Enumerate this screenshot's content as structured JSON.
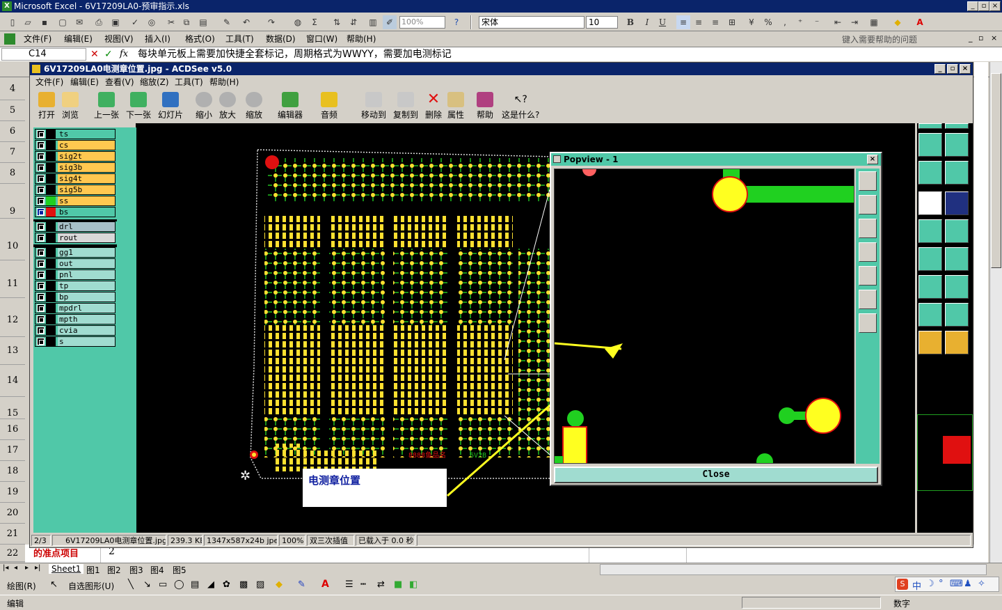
{
  "excel": {
    "title": "Microsoft Excel - 6V17209LA0-预审指示.xls",
    "menu": [
      "文件(F)",
      "编辑(E)",
      "视图(V)",
      "插入(I)",
      "格式(O)",
      "工具(T)",
      "数据(D)",
      "窗口(W)",
      "帮助(H)"
    ],
    "help_placeholder": "键入需要帮助的问题",
    "zoom": "100%",
    "font_name": "宋体",
    "font_size": "10",
    "cell_ref": "C14",
    "formula": "每块单元板上需要加快捷全套标记，周期格式为WWYY，需要加电测标记",
    "row_numbers": [
      "4",
      "5",
      "6",
      "7",
      "8",
      "9",
      "10",
      "11",
      "12",
      "13",
      "14",
      "15",
      "16",
      "17",
      "18",
      "19",
      "20",
      "21",
      "22"
    ],
    "row22_cell_a": "的准点项目",
    "row22_cell_b": "2",
    "sheet_tabs": [
      "Sheet1",
      "图1",
      "图2",
      "图3",
      "图4",
      "图5"
    ],
    "draw_label": "绘图(R)",
    "autoshape_label": "自选图形(U)",
    "status_left": "编辑",
    "status_right": "数字"
  },
  "acdsee": {
    "title": "6V17209LA0电测章位置.jpg - ACDSee v5.0",
    "menu": [
      "文件(F)",
      "编辑(E)",
      "查看(V)",
      "缩放(Z)",
      "工具(T)",
      "帮助(H)"
    ],
    "tools": [
      "打开",
      "浏览",
      "上一张",
      "下一张",
      "幻灯片",
      "缩小",
      "放大",
      "缩放",
      "编辑器",
      "音频",
      "移动到",
      "复制到",
      "删除",
      "属性",
      "帮助",
      "这是什么?"
    ],
    "layers": [
      {
        "name": "ts",
        "swatch": "#000000",
        "bg": "#50c8a8"
      },
      {
        "name": "cs",
        "swatch": "#000000",
        "bg": "#ffc850"
      },
      {
        "name": "sig2t",
        "swatch": "#000000",
        "bg": "#ffc850"
      },
      {
        "name": "sig3b",
        "swatch": "#000000",
        "bg": "#ffc850"
      },
      {
        "name": "sig4t",
        "swatch": "#000000",
        "bg": "#ffc850"
      },
      {
        "name": "sig5b",
        "swatch": "#000000",
        "bg": "#ffc850"
      },
      {
        "name": "ss",
        "swatch": "#20d020",
        "bg": "#ffc850"
      },
      {
        "name": "bs",
        "swatch": "#e01010",
        "bg": "#50c8a8"
      },
      {
        "name": "drl",
        "swatch": "#000000",
        "bg": "#a8c0c8"
      },
      {
        "name": "rout",
        "swatch": "#000000",
        "bg": "#d8d8d8"
      },
      {
        "name": "gg1",
        "swatch": "#000000",
        "bg": "#a0dcd0"
      },
      {
        "name": "out",
        "swatch": "#000000",
        "bg": "#a0dcd0"
      },
      {
        "name": "pnl",
        "swatch": "#000000",
        "bg": "#a0dcd0"
      },
      {
        "name": "tp",
        "swatch": "#000000",
        "bg": "#a0dcd0"
      },
      {
        "name": "bp",
        "swatch": "#000000",
        "bg": "#a0dcd0"
      },
      {
        "name": "mpdrl",
        "swatch": "#000000",
        "bg": "#a0dcd0"
      },
      {
        "name": "mpth",
        "swatch": "#000000",
        "bg": "#a0dcd0"
      },
      {
        "name": "cvia",
        "swatch": "#000000",
        "bg": "#a0dcd0"
      },
      {
        "name": "s",
        "swatch": "#000000",
        "bg": "#a0dcd0"
      }
    ],
    "annotation": "电测章位置",
    "pcb_text": "8888鱼品名\n6V2B",
    "popview_title": "Popview - 1",
    "popview_close": "Close",
    "status": [
      "2/3",
      "6V17209LA0电测章位置.jpg",
      "239.3 KB",
      "1347x587x24b jpeg",
      "100%",
      "双三次插值",
      "已载入于 0.0 秒"
    ]
  }
}
